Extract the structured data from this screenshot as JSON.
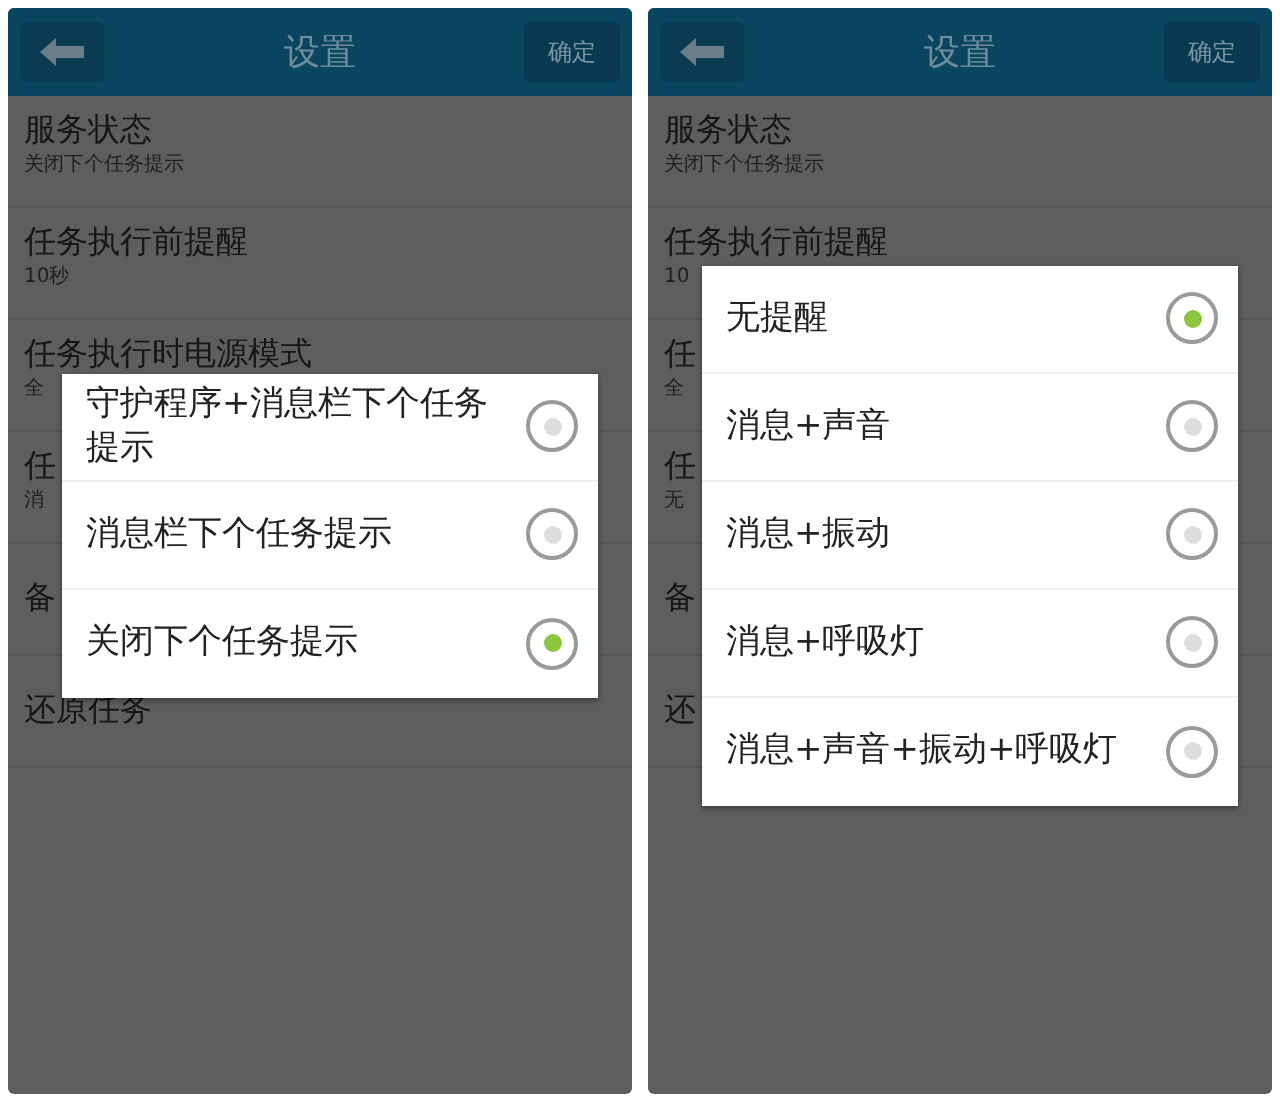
{
  "screens": [
    {
      "title": "设置",
      "confirm_button": "确定",
      "settings": [
        {
          "title": "服务状态",
          "subtitle": "关闭下个任务提示"
        },
        {
          "title": "任务执行前提醒",
          "subtitle": "10秒"
        },
        {
          "title": "任务执行时电源模式",
          "subtitle": "全"
        },
        {
          "title": "任",
          "subtitle": "消"
        },
        {
          "title": "备"
        },
        {
          "title": "还原任务"
        }
      ],
      "dialog": {
        "options": [
          {
            "label": "守护程序+消息栏下个任务提示",
            "selected": false
          },
          {
            "label": "消息栏下个任务提示",
            "selected": false
          },
          {
            "label": "关闭下个任务提示",
            "selected": true
          }
        ]
      }
    },
    {
      "title": "设置",
      "confirm_button": "确定",
      "settings": [
        {
          "title": "服务状态",
          "subtitle": "关闭下个任务提示"
        },
        {
          "title": "任务执行前提醒",
          "subtitle": "10"
        },
        {
          "title": "任",
          "subtitle": "全"
        },
        {
          "title": "任",
          "subtitle": "无"
        },
        {
          "title": "备"
        },
        {
          "title": "还"
        }
      ],
      "dialog": {
        "options": [
          {
            "label": "无提醒",
            "selected": true
          },
          {
            "label": "消息+声音",
            "selected": false
          },
          {
            "label": "消息+振动",
            "selected": false
          },
          {
            "label": "消息+呼吸灯",
            "selected": false
          },
          {
            "label": "消息+声音+振动+呼吸灯",
            "selected": false
          }
        ]
      }
    }
  ]
}
